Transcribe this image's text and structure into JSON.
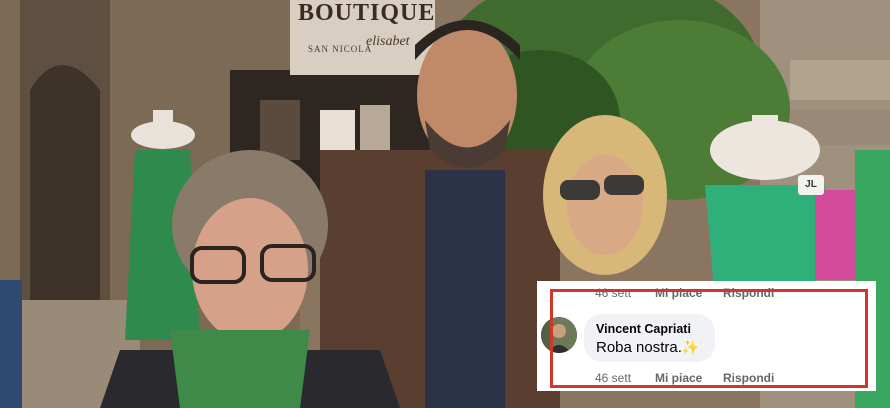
{
  "photo": {
    "sign_title": "BOUTIQUE",
    "sign_subtitle": "SAN NICOLA",
    "sign_brand": "elisabet",
    "tag": "JL"
  },
  "comment": {
    "top_meta": {
      "time": "46 sett",
      "like": "Mi piace",
      "reply": "Rispondi"
    },
    "author": "Vincent Capriati",
    "text": "Roba nostra.",
    "emoji": "✨",
    "bottom_meta": {
      "time": "46 sett",
      "like": "Mi piace",
      "reply": "Rispondi"
    },
    "highlight_color": "#d0362a"
  }
}
